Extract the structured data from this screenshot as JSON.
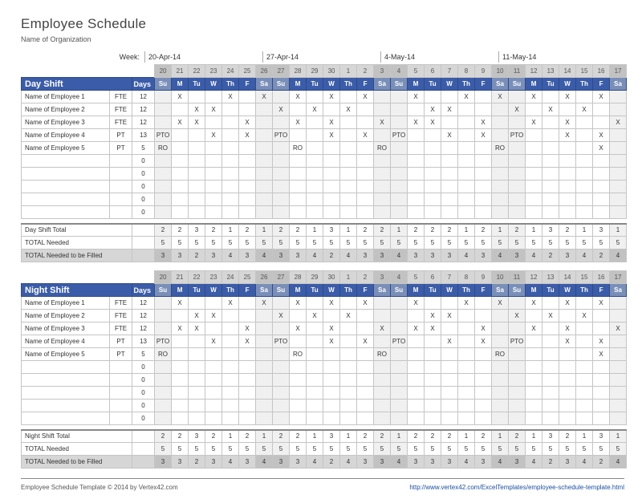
{
  "title": "Employee Schedule",
  "subtitle": "Name of Organization",
  "week_label": "Week:",
  "week_starts": [
    "20-Apr-14",
    "27-Apr-14",
    "4-May-14",
    "11-May-14"
  ],
  "day_nums": [
    "20",
    "21",
    "22",
    "23",
    "24",
    "25",
    "26",
    "27",
    "28",
    "29",
    "30",
    "1",
    "2",
    "3",
    "4",
    "5",
    "6",
    "7",
    "8",
    "9",
    "10",
    "11",
    "12",
    "13",
    "14",
    "15",
    "16",
    "17"
  ],
  "day_names": [
    "Su",
    "M",
    "Tu",
    "W",
    "Th",
    "F",
    "Sa",
    "Su",
    "M",
    "Tu",
    "W",
    "Th",
    "F",
    "Sa",
    "Su",
    "M",
    "Tu",
    "W",
    "Th",
    "F",
    "Sa",
    "Su",
    "M",
    "Tu",
    "W",
    "Th",
    "F",
    "Sa"
  ],
  "weekend_idx": [
    0,
    6,
    7,
    13,
    14,
    20,
    21,
    27
  ],
  "shifts": [
    {
      "name": "Day Shift",
      "days_hdr": "Days",
      "total_label": "Day Shift Total",
      "rows": [
        {
          "name": "Name of Employee 1",
          "type": "FTE",
          "days": "12",
          "cells": [
            "",
            "X",
            "",
            "",
            "X",
            "",
            "X",
            "",
            "X",
            "",
            "X",
            "",
            "X",
            "",
            "",
            "X",
            "",
            "",
            "X",
            "",
            "X",
            "",
            "X",
            "",
            "X",
            "",
            "X",
            ""
          ]
        },
        {
          "name": "Name of Employee 2",
          "type": "FTE",
          "days": "12",
          "cells": [
            "",
            "",
            "X",
            "X",
            "",
            "",
            "",
            "X",
            "",
            "X",
            "",
            "X",
            "",
            "",
            "",
            "",
            "X",
            "X",
            "",
            "",
            "",
            "X",
            "",
            "X",
            "",
            "X",
            "",
            ""
          ]
        },
        {
          "name": "Name of Employee 3",
          "type": "FTE",
          "days": "12",
          "cells": [
            "",
            "X",
            "X",
            "",
            "",
            "X",
            "",
            "",
            "X",
            "",
            "X",
            "",
            "",
            "X",
            "",
            "X",
            "X",
            "",
            "",
            "X",
            "",
            "",
            "X",
            "",
            "X",
            "",
            "",
            "X"
          ]
        },
        {
          "name": "Name of Employee 4",
          "type": "PT",
          "days": "13",
          "cells": [
            "PTO",
            "",
            "",
            "X",
            "",
            "X",
            "",
            "PTO",
            "",
            "",
            "X",
            "",
            "X",
            "",
            "PTO",
            "",
            "",
            "X",
            "",
            "X",
            "",
            "PTO",
            "",
            "",
            "X",
            "",
            "X",
            ""
          ]
        },
        {
          "name": "Name of Employee 5",
          "type": "PT",
          "days": "5",
          "cells": [
            "RO",
            "",
            "",
            "",
            "",
            "",
            "",
            "",
            "RO",
            "",
            "",
            "",
            "",
            "RO",
            "",
            "",
            "",
            "",
            "",
            "",
            "RO",
            "",
            "",
            "",
            "",
            "",
            "X",
            ""
          ]
        },
        {
          "name": "",
          "type": "",
          "days": "0",
          "cells": [
            "",
            "",
            "",
            "",
            "",
            "",
            "",
            "",
            "",
            "",
            "",
            "",
            "",
            "",
            "",
            "",
            "",
            "",
            "",
            "",
            "",
            "",
            "",
            "",
            "",
            "",
            "",
            ""
          ]
        },
        {
          "name": "",
          "type": "",
          "days": "0",
          "cells": [
            "",
            "",
            "",
            "",
            "",
            "",
            "",
            "",
            "",
            "",
            "",
            "",
            "",
            "",
            "",
            "",
            "",
            "",
            "",
            "",
            "",
            "",
            "",
            "",
            "",
            "",
            "",
            ""
          ]
        },
        {
          "name": "",
          "type": "",
          "days": "0",
          "cells": [
            "",
            "",
            "",
            "",
            "",
            "",
            "",
            "",
            "",
            "",
            "",
            "",
            "",
            "",
            "",
            "",
            "",
            "",
            "",
            "",
            "",
            "",
            "",
            "",
            "",
            "",
            "",
            ""
          ]
        },
        {
          "name": "",
          "type": "",
          "days": "0",
          "cells": [
            "",
            "",
            "",
            "",
            "",
            "",
            "",
            "",
            "",
            "",
            "",
            "",
            "",
            "",
            "",
            "",
            "",
            "",
            "",
            "",
            "",
            "",
            "",
            "",
            "",
            "",
            "",
            ""
          ]
        },
        {
          "name": "",
          "type": "",
          "days": "0",
          "cells": [
            "",
            "",
            "",
            "",
            "",
            "",
            "",
            "",
            "",
            "",
            "",
            "",
            "",
            "",
            "",
            "",
            "",
            "",
            "",
            "",
            "",
            "",
            "",
            "",
            "",
            "",
            "",
            ""
          ]
        }
      ],
      "total": [
        "2",
        "2",
        "3",
        "2",
        "1",
        "2",
        "1",
        "2",
        "2",
        "1",
        "3",
        "1",
        "2",
        "2",
        "1",
        "2",
        "2",
        "2",
        "1",
        "2",
        "1",
        "2",
        "1",
        "3",
        "2",
        "1",
        "3",
        "1"
      ],
      "needed_label": "TOTAL Needed",
      "needed": [
        "5",
        "5",
        "5",
        "5",
        "5",
        "5",
        "5",
        "5",
        "5",
        "5",
        "5",
        "5",
        "5",
        "5",
        "5",
        "5",
        "5",
        "5",
        "5",
        "5",
        "5",
        "5",
        "5",
        "5",
        "5",
        "5",
        "5",
        "5"
      ],
      "fill_label": "TOTAL Needed to be Filled",
      "fill": [
        "3",
        "3",
        "2",
        "3",
        "4",
        "3",
        "4",
        "3",
        "3",
        "4",
        "2",
        "4",
        "3",
        "3",
        "4",
        "3",
        "3",
        "3",
        "4",
        "3",
        "4",
        "3",
        "4",
        "2",
        "3",
        "4",
        "2",
        "4"
      ]
    },
    {
      "name": "Night Shift",
      "days_hdr": "Days",
      "total_label": "Night Shift Total",
      "rows": [
        {
          "name": "Name of Employee 1",
          "type": "FTE",
          "days": "12",
          "cells": [
            "",
            "X",
            "",
            "",
            "X",
            "",
            "X",
            "",
            "X",
            "",
            "X",
            "",
            "X",
            "",
            "",
            "X",
            "",
            "",
            "X",
            "",
            "X",
            "",
            "X",
            "",
            "X",
            "",
            "X",
            ""
          ]
        },
        {
          "name": "Name of Employee 2",
          "type": "FTE",
          "days": "12",
          "cells": [
            "",
            "",
            "X",
            "X",
            "",
            "",
            "",
            "X",
            "",
            "X",
            "",
            "X",
            "",
            "",
            "",
            "",
            "X",
            "X",
            "",
            "",
            "",
            "X",
            "",
            "X",
            "",
            "X",
            "",
            ""
          ]
        },
        {
          "name": "Name of Employee 3",
          "type": "FTE",
          "days": "12",
          "cells": [
            "",
            "X",
            "X",
            "",
            "",
            "X",
            "",
            "",
            "X",
            "",
            "X",
            "",
            "",
            "X",
            "",
            "X",
            "X",
            "",
            "",
            "X",
            "",
            "",
            "X",
            "",
            "X",
            "",
            "",
            "X"
          ]
        },
        {
          "name": "Name of Employee 4",
          "type": "PT",
          "days": "13",
          "cells": [
            "PTO",
            "",
            "",
            "X",
            "",
            "X",
            "",
            "PTO",
            "",
            "",
            "X",
            "",
            "X",
            "",
            "PTO",
            "",
            "",
            "X",
            "",
            "X",
            "",
            "PTO",
            "",
            "",
            "X",
            "",
            "X",
            ""
          ]
        },
        {
          "name": "Name of Employee 5",
          "type": "PT",
          "days": "5",
          "cells": [
            "RO",
            "",
            "",
            "",
            "",
            "",
            "",
            "",
            "RO",
            "",
            "",
            "",
            "",
            "RO",
            "",
            "",
            "",
            "",
            "",
            "",
            "RO",
            "",
            "",
            "",
            "",
            "",
            "X",
            ""
          ]
        },
        {
          "name": "",
          "type": "",
          "days": "0",
          "cells": [
            "",
            "",
            "",
            "",
            "",
            "",
            "",
            "",
            "",
            "",
            "",
            "",
            "",
            "",
            "",
            "",
            "",
            "",
            "",
            "",
            "",
            "",
            "",
            "",
            "",
            "",
            "",
            ""
          ]
        },
        {
          "name": "",
          "type": "",
          "days": "0",
          "cells": [
            "",
            "",
            "",
            "",
            "",
            "",
            "",
            "",
            "",
            "",
            "",
            "",
            "",
            "",
            "",
            "",
            "",
            "",
            "",
            "",
            "",
            "",
            "",
            "",
            "",
            "",
            "",
            ""
          ]
        },
        {
          "name": "",
          "type": "",
          "days": "0",
          "cells": [
            "",
            "",
            "",
            "",
            "",
            "",
            "",
            "",
            "",
            "",
            "",
            "",
            "",
            "",
            "",
            "",
            "",
            "",
            "",
            "",
            "",
            "",
            "",
            "",
            "",
            "",
            "",
            ""
          ]
        },
        {
          "name": "",
          "type": "",
          "days": "0",
          "cells": [
            "",
            "",
            "",
            "",
            "",
            "",
            "",
            "",
            "",
            "",
            "",
            "",
            "",
            "",
            "",
            "",
            "",
            "",
            "",
            "",
            "",
            "",
            "",
            "",
            "",
            "",
            "",
            ""
          ]
        },
        {
          "name": "",
          "type": "",
          "days": "0",
          "cells": [
            "",
            "",
            "",
            "",
            "",
            "",
            "",
            "",
            "",
            "",
            "",
            "",
            "",
            "",
            "",
            "",
            "",
            "",
            "",
            "",
            "",
            "",
            "",
            "",
            "",
            "",
            "",
            ""
          ]
        }
      ],
      "total": [
        "2",
        "2",
        "3",
        "2",
        "1",
        "2",
        "1",
        "2",
        "2",
        "1",
        "3",
        "1",
        "2",
        "2",
        "1",
        "2",
        "2",
        "2",
        "1",
        "2",
        "1",
        "2",
        "1",
        "3",
        "2",
        "1",
        "3",
        "1"
      ],
      "needed_label": "TOTAL Needed",
      "needed": [
        "5",
        "5",
        "5",
        "5",
        "5",
        "5",
        "5",
        "5",
        "5",
        "5",
        "5",
        "5",
        "5",
        "5",
        "5",
        "5",
        "5",
        "5",
        "5",
        "5",
        "5",
        "5",
        "5",
        "5",
        "5",
        "5",
        "5",
        "5"
      ],
      "fill_label": "TOTAL Needed to be Filled",
      "fill": [
        "3",
        "3",
        "2",
        "3",
        "4",
        "3",
        "4",
        "3",
        "3",
        "4",
        "2",
        "4",
        "3",
        "3",
        "4",
        "3",
        "3",
        "3",
        "4",
        "3",
        "4",
        "3",
        "4",
        "2",
        "3",
        "4",
        "2",
        "4"
      ]
    }
  ],
  "footer_left": "Employee Schedule Template © 2014 by Vertex42.com",
  "footer_right": "http://www.vertex42.com/ExcelTemplates/employee-schedule-template.html"
}
